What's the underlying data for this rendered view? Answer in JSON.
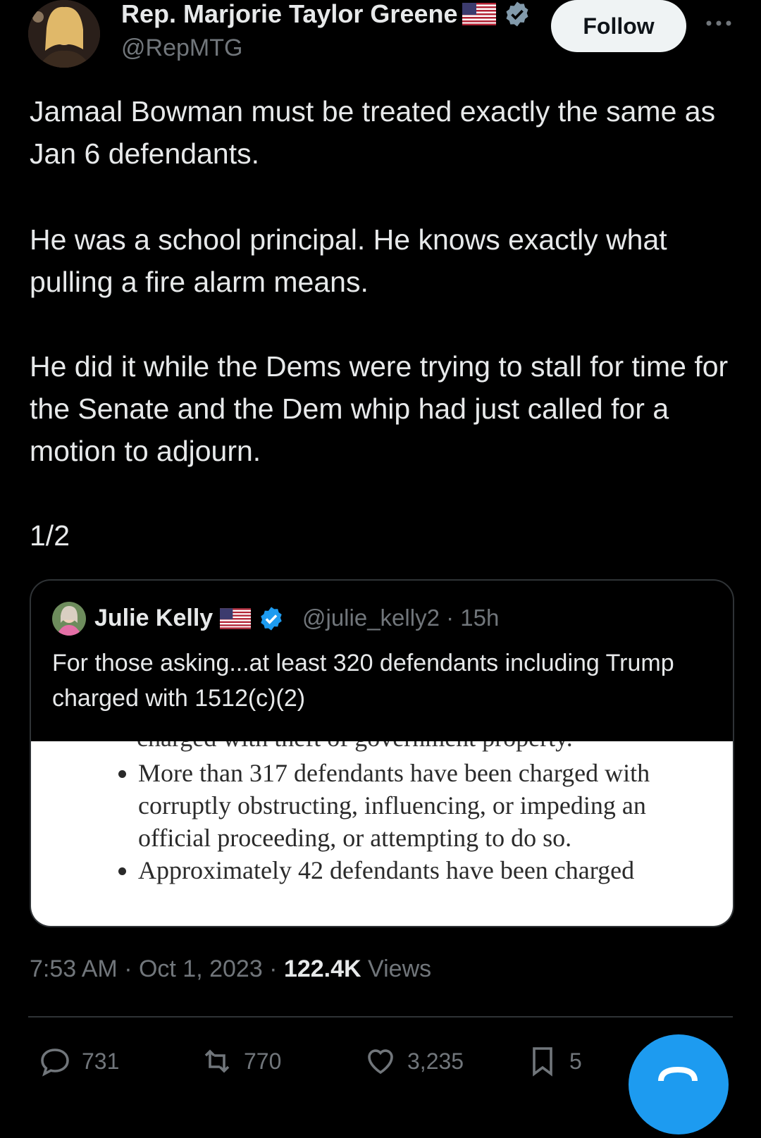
{
  "author": {
    "display_name": "Rep. Marjorie Taylor Greene",
    "handle": "@RepMTG",
    "follow_label": "Follow"
  },
  "tweet": {
    "paragraphs": [
      "Jamaal Bowman must be treated exactly the same as Jan 6 defendants.",
      "He was a school principal. He knows exactly what pulling a fire alarm means.",
      "He did it while the Dems were trying to stall for time for the Senate and the Dem whip had just called for a motion to adjourn.",
      "1/2"
    ]
  },
  "quote": {
    "display_name": "Julie Kelly",
    "handle_time": "@julie_kelly2 · 15h",
    "text": "For those asking...at least 320 defendants including Trump charged with 1512(c)(2)",
    "image": {
      "cut_line": "charged with theft of government property.",
      "bullet1": "More than 317 defendants have been charged with corruptly obstructing, influencing, or impeding an official proceeding, or attempting to do so.",
      "bullet2": "Approximately 42 defendants have been charged"
    }
  },
  "meta": {
    "time_date": "7:53 AM · Oct 1, 2023 · ",
    "views_count": "122.4K",
    "views_label": " Views"
  },
  "actions": {
    "replies": "731",
    "reposts": "770",
    "likes": "3,235",
    "bookmarks": "5"
  },
  "colors": {
    "background": "#000000",
    "text": "#e7e9ea",
    "muted": "#71767b",
    "accent": "#1d9bf0",
    "verified": "#1d9bf0"
  }
}
